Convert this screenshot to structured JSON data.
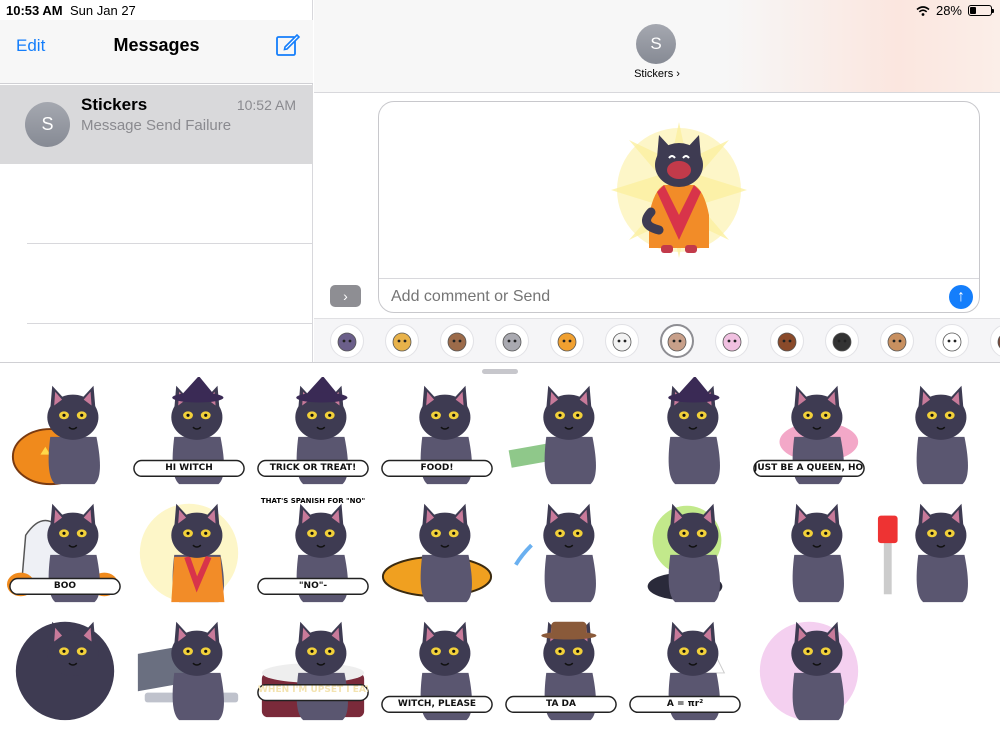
{
  "status_bar": {
    "time": "10:53 AM",
    "date": "Sun Jan 27",
    "battery": "28%",
    "battery_level": 0.28
  },
  "sidebar": {
    "edit_label": "Edit",
    "title": "Messages",
    "conversations": [
      {
        "initial": "S",
        "name": "Stickers",
        "time": "10:52 AM",
        "preview": "Message Send Failure"
      }
    ]
  },
  "chat": {
    "contact_initial": "S",
    "contact_name": "Stickers ›",
    "comment_placeholder": "Add comment or Send"
  },
  "colors": {
    "accent": "#147efb",
    "cat": "#3e3b52",
    "cat_light": "#5a5670",
    "eye": "#f2d13a"
  },
  "stickers": [
    {
      "name": "sticker-cat-pumpkin",
      "text": "",
      "prop": "pumpkin"
    },
    {
      "name": "sticker-hi-witch",
      "text": "HI WITCH",
      "prop": "witch-hat"
    },
    {
      "name": "sticker-trick-or-treat",
      "text": "TRICK OR TREAT!",
      "prop": "witch-hat"
    },
    {
      "name": "sticker-food",
      "text": "FOOD!",
      "prop": "bubble"
    },
    {
      "name": "sticker-money",
      "text": "",
      "prop": "money"
    },
    {
      "name": "sticker-witch-hat",
      "text": "",
      "prop": "witch-hat"
    },
    {
      "name": "sticker-queen",
      "text": "JUST BE A QUEEN, HONEY",
      "prop": "boa"
    },
    {
      "name": "sticker-meh",
      "text": "",
      "prop": ""
    },
    {
      "name": "sticker-boo",
      "text": "BOO",
      "prop": "ghost"
    },
    {
      "name": "sticker-happy-robe",
      "text": "",
      "prop": "robe"
    },
    {
      "name": "sticker-spanish",
      "text": "\"NO\"-",
      "text2": "THAT'S SPANISH FOR \"NO\"",
      "prop": "bubble"
    },
    {
      "name": "sticker-lying-plate",
      "text": "",
      "prop": "plate"
    },
    {
      "name": "sticker-crying",
      "text": "",
      "prop": "tears"
    },
    {
      "name": "sticker-cauldron",
      "text": "",
      "prop": "cauldron"
    },
    {
      "name": "sticker-side-eye",
      "text": "",
      "prop": ""
    },
    {
      "name": "sticker-mummy",
      "text": "",
      "prop": "mummy"
    },
    {
      "name": "sticker-fluffy",
      "text": "",
      "prop": "fluffy"
    },
    {
      "name": "sticker-laptop",
      "text": "",
      "prop": "laptop"
    },
    {
      "name": "sticker-upset-eat",
      "text": "WHEN I'M UPSET I EAT",
      "prop": "cake"
    },
    {
      "name": "sticker-witch-please",
      "text": "WITCH, PLEASE",
      "prop": "bubble"
    },
    {
      "name": "sticker-tada",
      "text": "TA DA",
      "prop": "hat"
    },
    {
      "name": "sticker-math",
      "text": "A = πr²",
      "prop": "math"
    },
    {
      "name": "sticker-rainbow",
      "text": "",
      "prop": "rainbow"
    }
  ],
  "app_strip": [
    "bat-cat",
    "heart-cat",
    "sloth",
    "gray-cat",
    "fox",
    "yeti",
    "selected-cat",
    "unicorn",
    "bear",
    "panda",
    "man",
    "stick-face",
    "glasses-man"
  ]
}
